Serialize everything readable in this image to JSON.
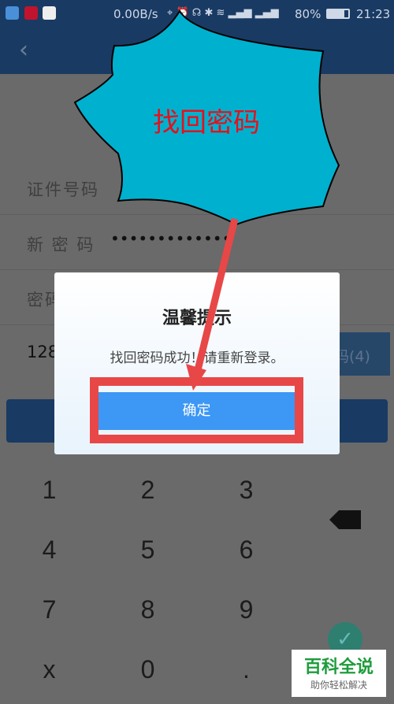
{
  "status_bar": {
    "net_speed": "0.00B/s",
    "battery": "80%",
    "time": "21:23",
    "icons": [
      "shield-app-icon",
      "netease-music-icon",
      "qq-icon",
      "location-icon",
      "alarm-icon",
      "headphones-icon",
      "bluetooth-icon",
      "wifi-icon",
      "signal-icon",
      "signal-icon",
      "battery-icon"
    ]
  },
  "header": {
    "back_icon": "chevron-left-icon"
  },
  "form": {
    "id_label": "证件号码",
    "new_password_label": "新 密 码",
    "new_password_value": "•••••••••••••",
    "confirm_label": "密码",
    "phone_value": "128",
    "code_button": "码(4)"
  },
  "keypad": {
    "keys": [
      "1",
      "2",
      "3",
      "4",
      "5",
      "6",
      "7",
      "8",
      "9",
      "x",
      "0",
      "."
    ],
    "backspace_icon": "backspace-icon",
    "confirm_icon": "check-icon"
  },
  "dialog": {
    "title": "温馨提示",
    "message": "找回密码成功！请重新登录。",
    "ok_button": "确定"
  },
  "annotation": {
    "callout_text": "找回密码",
    "callout_color": "#00b0cf",
    "highlight_color": "#e84747"
  },
  "watermark": {
    "line1": "百科全说",
    "line2": "助你轻松解决"
  }
}
